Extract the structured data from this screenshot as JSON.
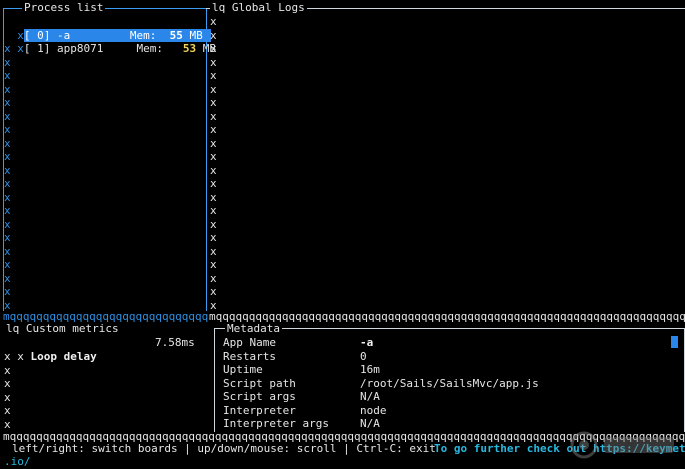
{
  "process_list": {
    "title": "Process list",
    "rows": [
      {
        "prefix": "x",
        "id": "[ 0]",
        "name": "-a",
        "mem_label": "Mem:",
        "mem_value": "55",
        "mem_unit": "MB",
        "selected": true
      },
      {
        "prefix": "x",
        "id": "[ 1]",
        "name": "app8071",
        "mem_label": "Mem:",
        "mem_value": "53",
        "mem_unit": "MB",
        "selected": false
      }
    ],
    "empty_marker": "x"
  },
  "global_logs": {
    "title_prefix": "lq",
    "title": "Global Logs",
    "marker": "x"
  },
  "custom_metrics": {
    "title_prefix": "lq",
    "title": "Custom metrics",
    "row_marker": "x",
    "metric_label": "Loop delay",
    "metric_value": "7.58ms"
  },
  "metadata": {
    "title": "Metadata",
    "rows": [
      {
        "key": "App Name",
        "value": "-a",
        "bold": true
      },
      {
        "key": "Restarts",
        "value": "0"
      },
      {
        "key": "Uptime",
        "value": "16m"
      },
      {
        "key": "Script path",
        "value": "/root/Sails/SailsMvc/app.js"
      },
      {
        "key": "Script args",
        "value": "N/A"
      },
      {
        "key": "Interpreter",
        "value": "node"
      },
      {
        "key": "Interpreter args",
        "value": "N/A"
      }
    ]
  },
  "border_row": "mqqqqqqqqqqqqqqqqqqqqqqqqqqqqqqqqqqqqqqqqqqqqqqqqqqqqqqqqqqqqqqqqqqqqqqqqqqqqqqqqqqqqqqqqqqqqqqqqqqqqqqqqqqqq",
  "footer": {
    "help_text": "left/right: switch boards | up/down/mouse: scroll | Ctrl-C: exit",
    "promo_text": "To go further check out https://keymetrics",
    "promo_tail": ".io/"
  },
  "colors": {
    "accent": "#2a86e8",
    "memory": "#f2d35c",
    "cyan": "#27b9e0"
  }
}
